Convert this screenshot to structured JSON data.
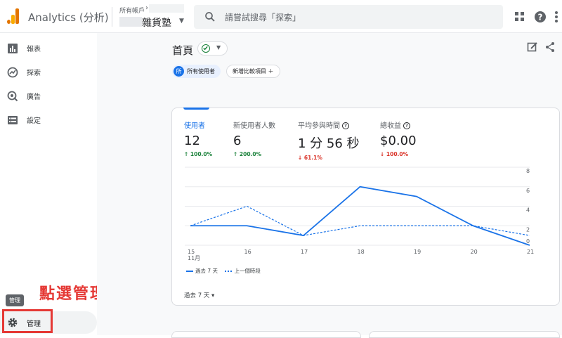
{
  "header": {
    "app_title": "Analytics (分析)",
    "account_label": "所有帳戶",
    "property_name": "雜貨塾",
    "search_placeholder": "請嘗試搜尋「探索」"
  },
  "sidebar": {
    "items": [
      {
        "label": "報表",
        "icon": "bar-chart-icon"
      },
      {
        "label": "探索",
        "icon": "explore-icon"
      },
      {
        "label": "廣告",
        "icon": "ads-icon"
      },
      {
        "label": "設定",
        "icon": "list-icon"
      }
    ],
    "admin_tooltip": "管理",
    "admin_label": "管理"
  },
  "annotation": {
    "text": "點選管理",
    "color": "#e53935"
  },
  "page": {
    "title": "首頁",
    "segment_avatar": "所",
    "segment_label": "所有使用者",
    "add_comparison": "新增比較項目 ＋"
  },
  "metrics": [
    {
      "label": "使用者",
      "value": "12",
      "change": "↑ 100.0%",
      "direction": "up",
      "active": true
    },
    {
      "label": "新使用者人數",
      "value": "6",
      "change": "↑ 200.0%",
      "direction": "up",
      "active": false
    },
    {
      "label": "平均參與時間",
      "value": "1 分 56 秒",
      "change": "↓ 61.1%",
      "direction": "down",
      "active": false
    },
    {
      "label": "總收益",
      "value": "$0.00",
      "change": "↓ 100.0%",
      "direction": "down",
      "active": false
    }
  ],
  "chart_data": {
    "type": "line",
    "categories": [
      "15",
      "16",
      "17",
      "18",
      "19",
      "20",
      "21"
    ],
    "x_sublabel": "11月",
    "ylim": [
      0,
      8
    ],
    "yticks": [
      "8",
      "6",
      "4",
      "2",
      "0"
    ],
    "series": [
      {
        "name": "過去 7 天",
        "style": "solid",
        "values": [
          2,
          2,
          1,
          6,
          5,
          2,
          0
        ]
      },
      {
        "name": "上一個時段",
        "style": "dashed",
        "values": [
          2,
          4,
          1,
          2,
          2,
          2,
          1
        ]
      }
    ],
    "color": "#1a73e8",
    "grid": true
  },
  "footer": {
    "date_range": "過去 7 天 ▾"
  }
}
